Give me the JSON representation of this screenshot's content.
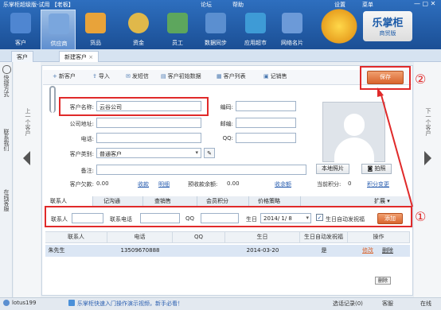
{
  "app": {
    "title": "乐掌柜超级版-试用 【老板】",
    "top_links": [
      "论坛",
      "帮助",
      "设置",
      "菜单"
    ],
    "brand_line1": "乐掌柜",
    "brand_line2": "商贸版"
  },
  "nav": [
    {
      "label": "客户",
      "icon": "customer-icon",
      "color": "#4f86d1"
    },
    {
      "label": "供应商",
      "icon": "supplier-icon",
      "color": "#7aa6dd"
    },
    {
      "label": "货品",
      "icon": "goods-icon",
      "color": "#e8a33a"
    },
    {
      "label": "资金",
      "icon": "money-icon",
      "color": "#e0b84a"
    },
    {
      "label": "员工",
      "icon": "staff-icon",
      "color": "#5da65d"
    },
    {
      "label": "数据同步",
      "icon": "sync-icon",
      "color": "#5b8fd0"
    },
    {
      "label": "应用超市",
      "icon": "store-icon",
      "color": "#3e9bd6"
    },
    {
      "label": "网络名片",
      "icon": "card-icon",
      "color": "#6c9ad8"
    }
  ],
  "window_tabs": [
    "客户",
    "新建客户"
  ],
  "left_side": [
    "快捷方式",
    "联系我们",
    "在线客服"
  ],
  "prev_label": "上一个客户",
  "next_label": "下一个客户",
  "toolbar": {
    "new": "新客户",
    "import": "导入",
    "sms": "发短信",
    "initial": "客户初始数据",
    "list": "客户列表",
    "diary": "记销售",
    "save": "保存"
  },
  "form": {
    "name_label": "客户名称:",
    "name_value": "云谷公司",
    "address_label": "公司地址:",
    "phone_label": "电话:",
    "type_label": "客户类别:",
    "type_value": "普通客户",
    "remark_label": "备注:",
    "balance_label": "客户欠款:",
    "balance_value": "0.00",
    "receive_link": "收款",
    "detail_link": "明细",
    "prepaid_label": "预收款余额:",
    "prepaid_value": "0.00",
    "prepaid_link": "收余额",
    "points_label": "当前积分:",
    "points_value": "0",
    "change_link": "积分变更",
    "code_label": "编码:",
    "fax_label": "邮编:",
    "qq_label": "QQ:"
  },
  "photo": {
    "upload": "本地照片",
    "camera": "拍照"
  },
  "lower_tabs": [
    "联系人",
    "记沟通",
    "查销售",
    "会员积分",
    "价格策略"
  ],
  "lower_tabs_expand": "扩展",
  "contact_form": {
    "contact": "联系人",
    "phone": "联系电话",
    "qq": "QQ",
    "birthday": "生日",
    "birthday_value": "2014/ 1/ 8",
    "auto_wish": "生日自动发祝福",
    "add": "添加"
  },
  "table": {
    "headers": [
      "联系人",
      "电话",
      "QQ",
      "生日",
      "生日自动发祝福",
      "操作"
    ],
    "rows": [
      {
        "name": "朱先生",
        "phone": "13509670888",
        "qq": "",
        "birthday": "2014-03-20",
        "wish": "是",
        "edit": "修改",
        "delete": "删除"
      }
    ]
  },
  "delete_tip": "删除",
  "status": {
    "user": "lotus199",
    "promo": "乐掌柜快速入门操作演示视频，新手必看！",
    "records": "选话记录(0)",
    "service": "客服",
    "online": "在线"
  },
  "annotations": {
    "one": "①",
    "two": "②"
  }
}
